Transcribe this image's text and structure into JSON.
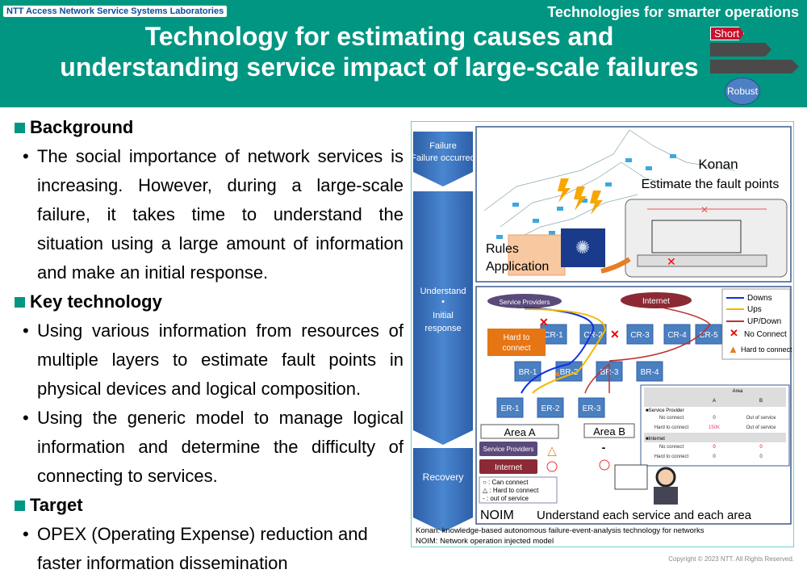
{
  "header": {
    "lab": "NTT Access Network Service Systems Laboratories",
    "category": "Technologies for smarter operations",
    "title_line1": "Technology for estimating causes and",
    "title_line2": "understanding service impact of large-scale failures",
    "badge_short": "Short",
    "badge_robust": "Robust"
  },
  "sections": [
    {
      "heading": "Background",
      "bullets": [
        "The social importance of network services is increasing. However, during a large-scale failure, it takes time to understand the situation using a large amount of information and make an initial response."
      ]
    },
    {
      "heading": "Key technology",
      "bullets": [
        "Using various information from resources of multiple layers to estimate fault points in physical devices and logical composition.",
        "Using the generic model to manage logical information and determine the difficulty of connecting to services."
      ]
    },
    {
      "heading": "Target",
      "bullets": [
        "OPEX (Operating Expense) reduction and faster information dissemination"
      ]
    }
  ],
  "diagram": {
    "phases": [
      "Failure occurred",
      "Understand",
      "•",
      "Initial",
      "response",
      "Recovery"
    ],
    "konan": "Konan",
    "estimate": "Estimate the fault points",
    "rules": "Rules",
    "application": "Application",
    "service_providers": "Service Providers",
    "internet": "Internet",
    "nodes": [
      "CR-1",
      "CR-2",
      "CR-3",
      "CR-4",
      "CR-5",
      "BR-1",
      "BR-2",
      "BR-3",
      "BR-4",
      "ER-1",
      "ER-2",
      "ER-3"
    ],
    "hard_callout": [
      "Hard to",
      "connect"
    ],
    "legend": [
      "Downs",
      "Ups",
      "UP/Down",
      "No Connect",
      "Hard to connect"
    ],
    "area_a": "Area A",
    "area_b": "Area B",
    "area_b_sp": "-",
    "key": [
      "○ : Can connect",
      "△ : Hard to connect",
      "-  : out of service"
    ],
    "table": {
      "header": "Area",
      "cols": [
        "A",
        "B"
      ],
      "sp": "■Service Provider",
      "inet": "■Internet",
      "rows_sp": [
        [
          "No connect",
          "0",
          "Out of service"
        ],
        [
          "Hard to connect",
          "150K",
          "Out of service"
        ]
      ],
      "rows_inet": [
        [
          "No connect",
          "0",
          "0"
        ],
        [
          "Hard to connect",
          "0",
          "0"
        ]
      ]
    },
    "noim": "NOIM",
    "understand": "Understand each service and each area",
    "foot1": "Konan: knowledge-based autonomous failure-event-analysis technology for networks",
    "foot2": "NOIM: Network operation injected model"
  },
  "copyright": "Copyright © 2023 NTT. All Rights Reserved."
}
